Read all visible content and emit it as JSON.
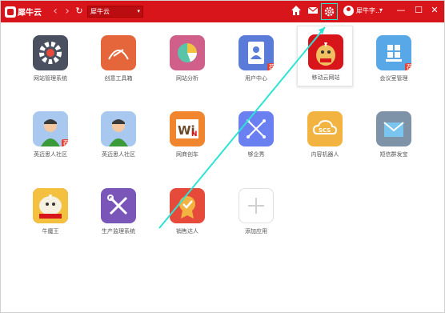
{
  "app": {
    "logo_text": "犀牛云",
    "address_value": "犀牛云"
  },
  "user": {
    "name": "犀牛字..."
  },
  "apps": [
    {
      "label": "网站管理系统",
      "color": "#4a5060"
    },
    {
      "label": "创意工具箱",
      "color": "#e4663a"
    },
    {
      "label": "网站分析",
      "color": "#d0608a"
    },
    {
      "label": "用户中心",
      "color": "#5a7bd8"
    },
    {
      "label": "移动云网站",
      "color": "#d9151c"
    },
    {
      "label": "会议室管理",
      "color": "#58a8e8"
    },
    {
      "label": "英迈思人社区",
      "color": "#a8c8f0"
    },
    {
      "label": "英迈思人社区",
      "color": "#a8c8f0"
    },
    {
      "label": "网商创车",
      "color": "#f0852e"
    },
    {
      "label": "够企秀",
      "color": "#6a7ff0"
    },
    {
      "label": "内容机器人",
      "color": "#f3b340"
    },
    {
      "label": "短信群发宝",
      "color": "#7f93a8"
    },
    {
      "label": "牛魔王",
      "color": "#d9151c"
    },
    {
      "label": "生产监理系统",
      "color": "#7a56b8"
    },
    {
      "label": "销售达人",
      "color": "#e64a3a"
    },
    {
      "label": "添加应用",
      "color": "#ffffff"
    }
  ],
  "badge_text": "荐"
}
